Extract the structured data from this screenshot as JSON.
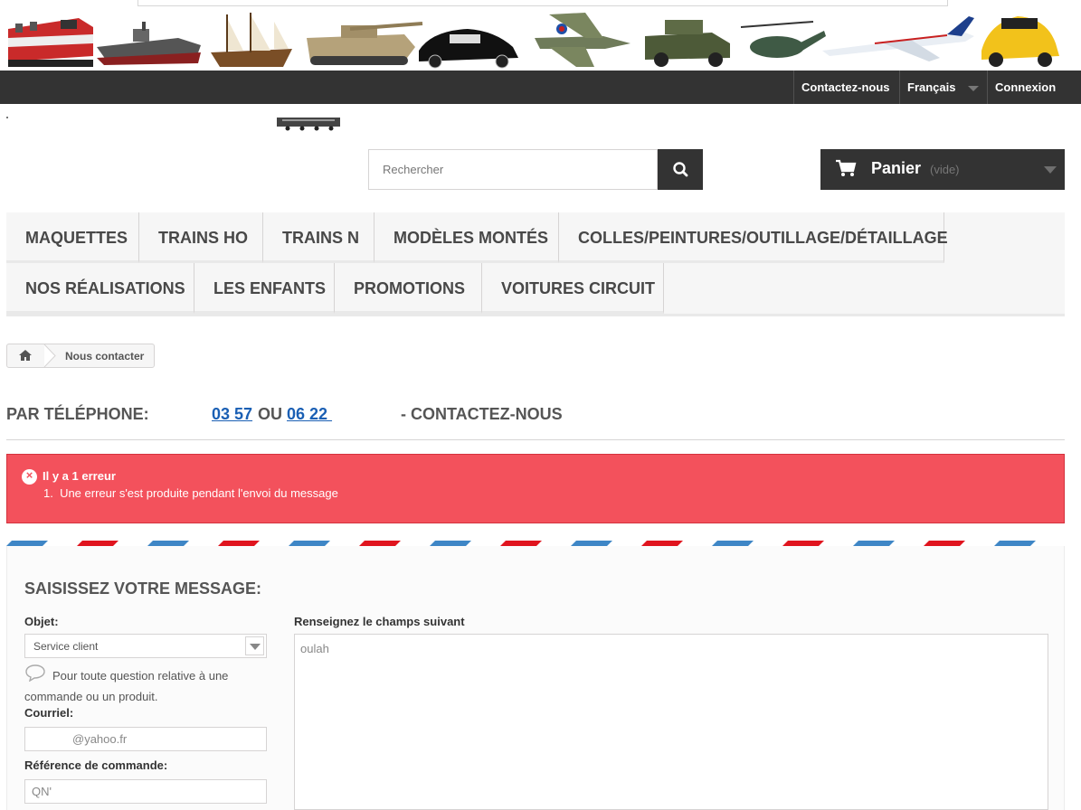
{
  "nav": {
    "contact": "Contactez-nous",
    "language": "Français",
    "login": "Connexion"
  },
  "search": {
    "placeholder": "Rechercher"
  },
  "cart": {
    "label": "Panier",
    "status": "(vide)"
  },
  "menu": {
    "items": [
      "MAQUETTES",
      "TRAINS HO",
      "TRAINS N",
      "MODÈLES MONTÉS",
      "COLLES/PEINTURES/OUTILLAGE/DÉTAILLAGE",
      "NOS RÉALISATIONS",
      "LES ENFANTS",
      "PROMOTIONS",
      "VOITURES CIRCUIT"
    ]
  },
  "breadcrumb": {
    "current": "Nous contacter"
  },
  "phone": {
    "label": "PAR TÉLÉPHONE:",
    "number1": "03 57",
    "or": "OU",
    "number2": "06 22 ",
    "contact": "- CONTACTEZ-NOUS"
  },
  "error": {
    "title": "Il y a 1 erreur",
    "message": "1.  Une erreur s'est produite pendant l'envoi du message"
  },
  "form": {
    "heading": "SAISISSEZ VOTRE MESSAGE:",
    "subject_label": "Objet:",
    "subject_value": "Service client",
    "help_text": "Pour toute question relative à une commande ou un produit.",
    "email_label": "Courriel:",
    "email_value": "@yahoo.fr",
    "order_label": "Référence de commande:",
    "order_value": "QN'",
    "message_label": "Renseignez le champs suivant",
    "message_value": "oulah"
  },
  "colors": {
    "nav_bg": "#333333",
    "error_bg": "#f3515c",
    "link": "#1a5fb4",
    "mail_red": "#e0141e",
    "mail_blue": "#3e86c6"
  }
}
